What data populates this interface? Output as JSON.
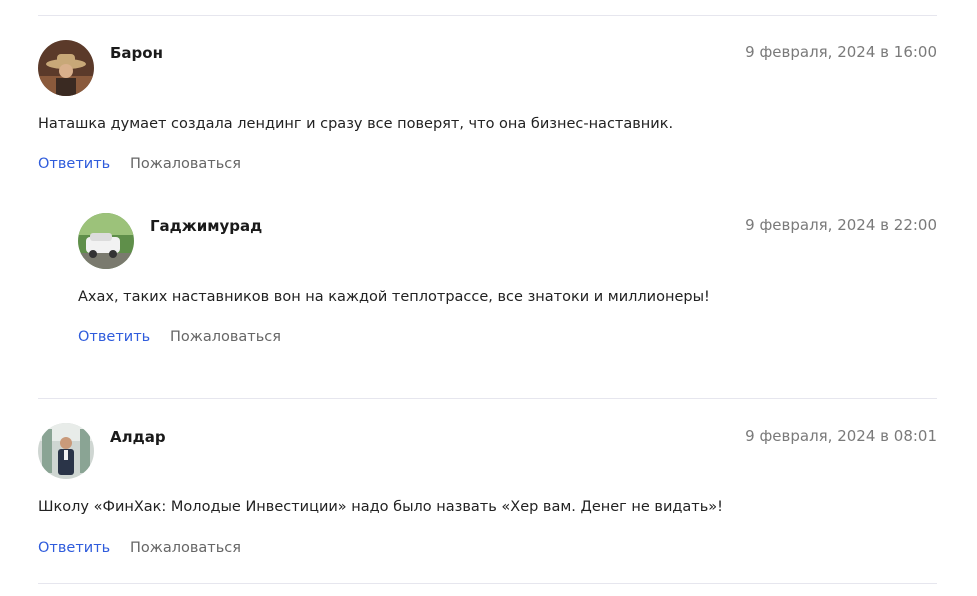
{
  "comments": [
    {
      "author": "Барон",
      "date": "9 февраля, 2024 в 16:00",
      "text": "Наташка думает создала лендинг и сразу все поверят, что она бизнес-наставник.",
      "reply_label": "Ответить",
      "report_label": "Пожаловаться",
      "avatar": "avatar-photo-man-in-hat"
    },
    {
      "author": "Гаджимурад",
      "date": "9 февраля, 2024 в 22:00",
      "text": "Ахах, таких наставников вон на каждой теплотрассе, все знатоки и миллионеры!",
      "reply_label": "Ответить",
      "report_label": "Пожаловаться",
      "avatar": "avatar-photo-white-car"
    },
    {
      "author": "Алдар",
      "date": "9 февраля, 2024 в 08:01",
      "text": "Школу «ФинХак: Молодые Инвестиции» надо было назвать «Хер вам. Денег не видать»!",
      "reply_label": "Ответить",
      "report_label": "Пожаловаться",
      "avatar": "avatar-photo-man-in-suit"
    }
  ],
  "colors": {
    "link": "#2f5cdc",
    "date": "#7a7a7a",
    "divider": "#e6e6ee"
  }
}
